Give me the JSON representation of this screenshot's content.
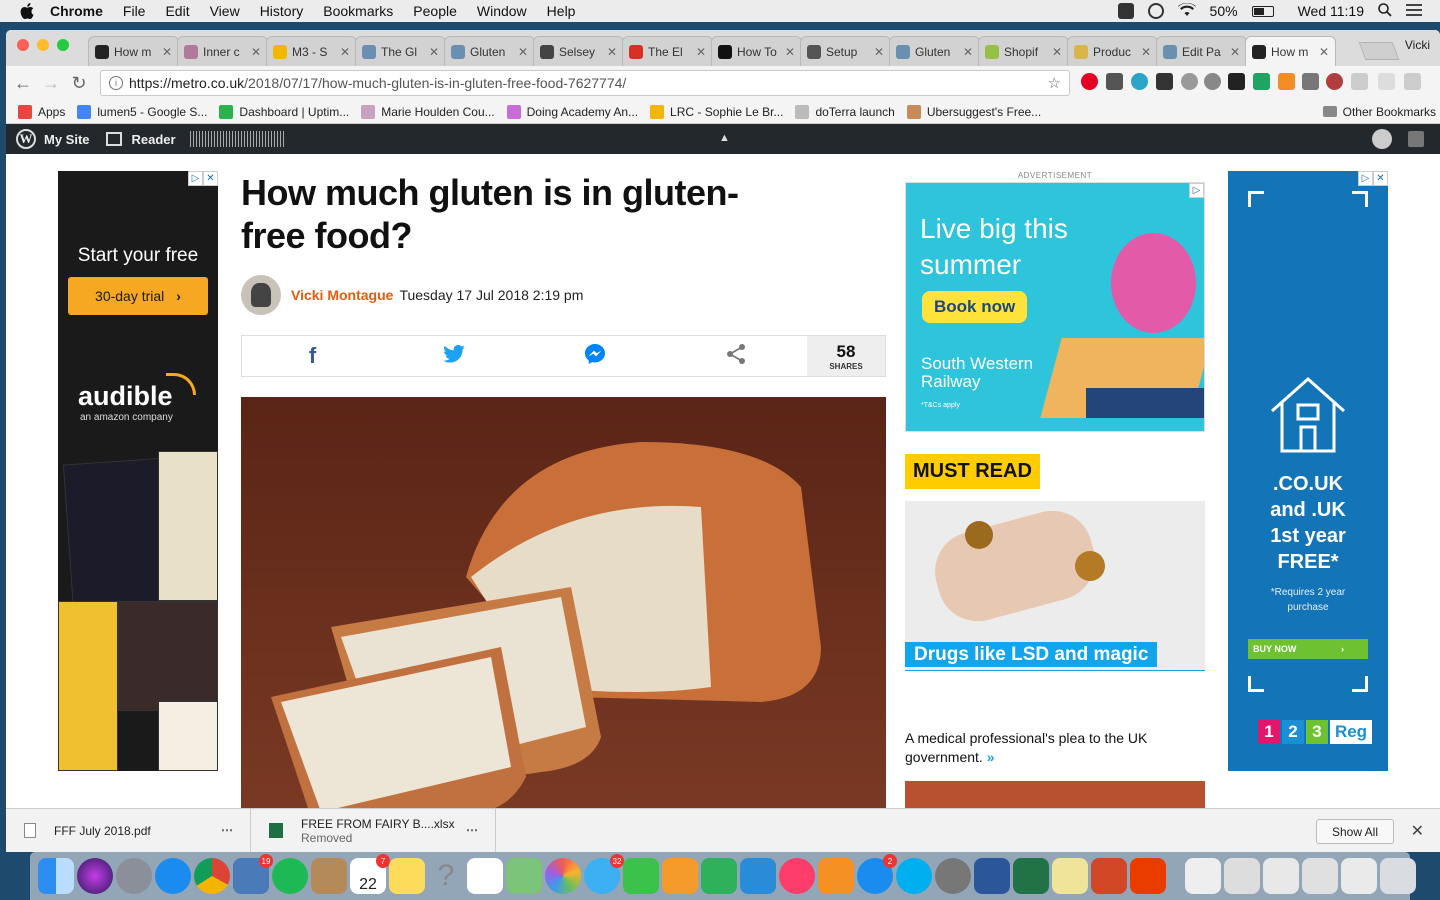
{
  "menubar": {
    "app": "Chrome",
    "items": [
      "File",
      "Edit",
      "View",
      "History",
      "Bookmarks",
      "People",
      "Window",
      "Help"
    ],
    "battery": "50%",
    "clock": "Wed 11:19"
  },
  "tabs": [
    {
      "label": "How m",
      "color": "#222222",
      "active": false
    },
    {
      "label": "Inner c",
      "color": "#b07a9a",
      "active": false
    },
    {
      "label": "M3 - S",
      "color": "#f2b705",
      "active": false
    },
    {
      "label": "The Gl",
      "color": "#6a8fb0",
      "active": false
    },
    {
      "label": "Gluten",
      "color": "#6a8fb0",
      "active": false
    },
    {
      "label": "Selsey",
      "color": "#444444",
      "active": false
    },
    {
      "label": "The El",
      "color": "#d93025",
      "active": false
    },
    {
      "label": "How To",
      "color": "#111111",
      "active": false
    },
    {
      "label": "Setup",
      "color": "#555555",
      "active": false
    },
    {
      "label": "Gluten",
      "color": "#6a8fb0",
      "active": false
    },
    {
      "label": "Shopif",
      "color": "#95bf47",
      "active": false
    },
    {
      "label": "Produc",
      "color": "#d9b54a",
      "active": false
    },
    {
      "label": "Edit Pa",
      "color": "#6a8fb0",
      "active": false
    },
    {
      "label": "How m",
      "color": "#222222",
      "active": true
    }
  ],
  "profile": "Vicki",
  "address": {
    "domain": "https://metro.co.uk",
    "path": "/2018/07/17/how-much-gluten-is-in-gluten-free-food-7627774/"
  },
  "bookmarks": [
    {
      "label": "Apps",
      "color": "#e8453c"
    },
    {
      "label": "lumen5 - Google S...",
      "color": "#4285f4"
    },
    {
      "label": "Dashboard | Uptim...",
      "color": "#2bb24c"
    },
    {
      "label": "Marie Houlden Cou...",
      "color": "#c9a0c0"
    },
    {
      "label": "Doing Academy An...",
      "color": "#c86dd7"
    },
    {
      "label": "LRC - Sophie Le Br...",
      "color": "#f2b705"
    },
    {
      "label": "doTerra launch",
      "color": "#bbbbbb"
    },
    {
      "label": "Ubersuggest's Free...",
      "color": "#c98a5a"
    }
  ],
  "other_bookmarks": "Other Bookmarks",
  "wpbar": {
    "my_site": "My Site",
    "reader": "Reader"
  },
  "article": {
    "headline": "How much gluten is in gluten-free food?",
    "author": "Vicki Montague",
    "date": "Tuesday 17 Jul 2018 2:19 pm",
    "share_count": "58",
    "share_label": "SHARES"
  },
  "ad_left": {
    "title": "Start your free",
    "button": "30-day trial",
    "logo": "audible",
    "sub": "an amazon company"
  },
  "sidebar": {
    "ad_label": "ADVERTISEMENT",
    "swr_headline": "Live big this summer",
    "swr_button": "Book now",
    "swr_brand": "South Western Railway",
    "swr_tc": "*T&Cs apply",
    "must_read": "MUST READ",
    "mr_title": "Drugs like LSD and magic mushrooms should be legalised for medical use",
    "mr_desc": "A medical professional's plea to the UK government.",
    "mr_more": "»"
  },
  "ad_right": {
    "line1": ".CO.UK",
    "line2": "and .UK",
    "line3": "1st year",
    "line4": "FREE*",
    "req": "*Requires 2 year purchase",
    "buy": "BUY NOW",
    "reg_1": "1",
    "reg_2": "2",
    "reg_3": "3",
    "reg_word": "Reg"
  },
  "downloads": [
    {
      "name": "FFF July 2018.pdf",
      "status": ""
    },
    {
      "name": "FREE FROM FAIRY B....xlsx",
      "status": "Removed"
    }
  ],
  "show_all": "Show All",
  "dock": {
    "badge_photos": "19",
    "badge_calendar": "7",
    "calendar_day": "22",
    "badge_messages": "32",
    "badge_appstore": "2"
  }
}
